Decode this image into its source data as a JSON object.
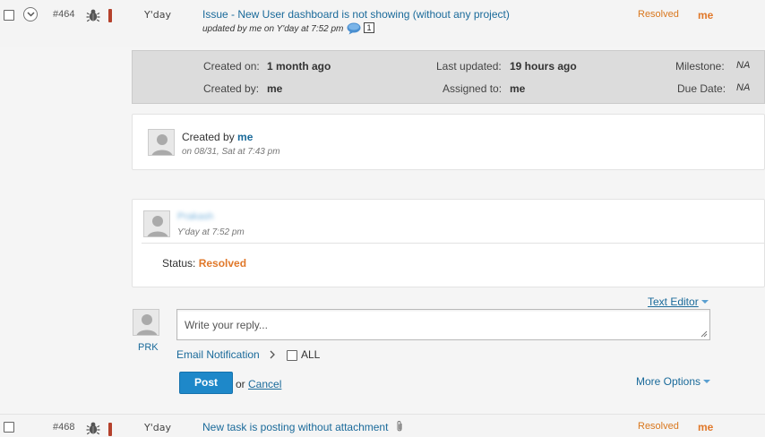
{
  "task_464": {
    "number": "#464",
    "date": "Y'day",
    "title": "Issue - New User dashboard is not showing (without any project)",
    "updated": "updated by me on Y'day at 7:52 pm",
    "comment_count": "1",
    "status": "Resolved",
    "assignee": "me"
  },
  "meta": {
    "created_on_label": "Created on:",
    "created_on_value": "1 month ago",
    "created_by_label": "Created by:",
    "created_by_value": "me",
    "last_updated_label": "Last updated:",
    "last_updated_value": "19 hours ago",
    "assigned_to_label": "Assigned to:",
    "assigned_to_value": "me",
    "milestone_label": "Milestone:",
    "milestone_value": "NA",
    "due_date_label": "Due Date:",
    "due_date_value": "NA"
  },
  "creation_card": {
    "prefix": "Created by ",
    "user": "me",
    "date": "on 08/31, Sat at 7:43 pm"
  },
  "comment_card": {
    "user": "Prakash",
    "date": "Y'day at 7:52 pm",
    "status_label": "Status: ",
    "status_value": "Resolved"
  },
  "reply": {
    "text_editor": "Text Editor",
    "placeholder": "Write your reply...",
    "avatar_label": "PRK",
    "email_notification": "Email Notification",
    "all_label": "ALL",
    "post": "Post",
    "or": "or",
    "cancel": "Cancel",
    "more_options": "More Options"
  },
  "task_468": {
    "number": "#468",
    "date": "Y'day",
    "title": "New task is posting without attachment",
    "status": "Resolved",
    "assignee": "me"
  },
  "colors": {
    "link": "#1a6a9a",
    "status_orange": "#e0782a",
    "priority_red": "#b5412c",
    "post_button": "#1e88c9"
  },
  "icons": [
    "expand-chevron-icon",
    "bug-icon",
    "comment-bubble-icon",
    "avatar-icon",
    "chevron-right-icon",
    "attachment-icon",
    "dropdown-caret-icon"
  ]
}
